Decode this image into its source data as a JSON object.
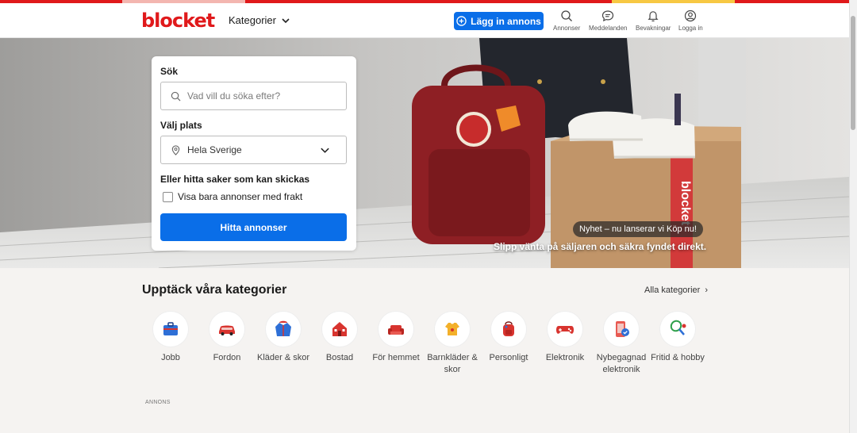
{
  "brand": {
    "name": "blocket",
    "color": "#e0191b",
    "accent_blue": "#0a6ee8"
  },
  "header": {
    "categories_label": "Kategorier",
    "post_ad_label": "Lägg in annons",
    "nav": [
      {
        "label": "Annonser",
        "icon": "search-icon"
      },
      {
        "label": "Meddelanden",
        "icon": "chat-icon"
      },
      {
        "label": "Bevakningar",
        "icon": "bell-icon"
      },
      {
        "label": "Logga in",
        "icon": "user-icon"
      }
    ]
  },
  "search": {
    "search_label": "Sök",
    "search_placeholder": "Vad vill du söka efter?",
    "location_label": "Välj plats",
    "location_value": "Hela Sverige",
    "shipping_heading": "Eller hitta saker som kan skickas",
    "shipping_checkbox_label": "Visa bara annonser med frakt",
    "shipping_checked": false,
    "submit_label": "Hitta annonser"
  },
  "hero": {
    "badge": "Nyhet – nu lanserar vi Köp nu!",
    "tagline": "Slipp vänta på säljaren och säkra fyndet direkt.",
    "box_text": "blocket"
  },
  "categories_section": {
    "title": "Upptäck våra kategorier",
    "all_link": "Alla kategorier",
    "items": [
      {
        "label": "Jobb",
        "icon": "briefcase-icon"
      },
      {
        "label": "Fordon",
        "icon": "car-icon"
      },
      {
        "label": "Kläder & skor",
        "icon": "jacket-icon"
      },
      {
        "label": "Bostad",
        "icon": "house-icon"
      },
      {
        "label": "För hemmet",
        "icon": "armchair-icon"
      },
      {
        "label": "Barnkläder & skor",
        "icon": "baby-shirt-icon"
      },
      {
        "label": "Personligt",
        "icon": "backpack-icon"
      },
      {
        "label": "Elektronik",
        "icon": "gamepad-icon"
      },
      {
        "label": "Nybegagnad elektronik",
        "icon": "phone-badge-icon"
      },
      {
        "label": "Fritid & hobby",
        "icon": "racket-icon"
      }
    ]
  },
  "ad_label": "ANNONS"
}
